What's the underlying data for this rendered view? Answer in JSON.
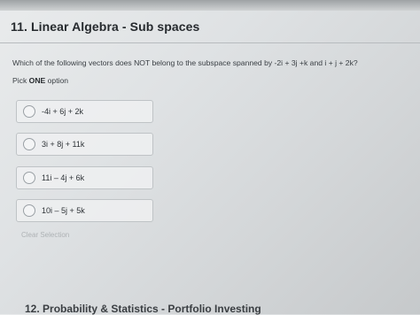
{
  "question": {
    "title": "11. Linear Algebra - Sub spaces",
    "prompt": "Which of the following vectors does NOT belong to the subspace spanned by -2i + 3j +k and i + j + 2k?",
    "pick_prefix": "Pick",
    "pick_bold": "ONE",
    "pick_suffix": "option"
  },
  "options": [
    {
      "label": "-4i + 6j + 2k"
    },
    {
      "label": "3i + 8j + 11k"
    },
    {
      "label": "11i – 4j + 6k"
    },
    {
      "label": "10i – 5j + 5k"
    }
  ],
  "clear_selection": "Clear Selection",
  "next_section_title": "12. Probability & Statistics - Portfolio Investing"
}
